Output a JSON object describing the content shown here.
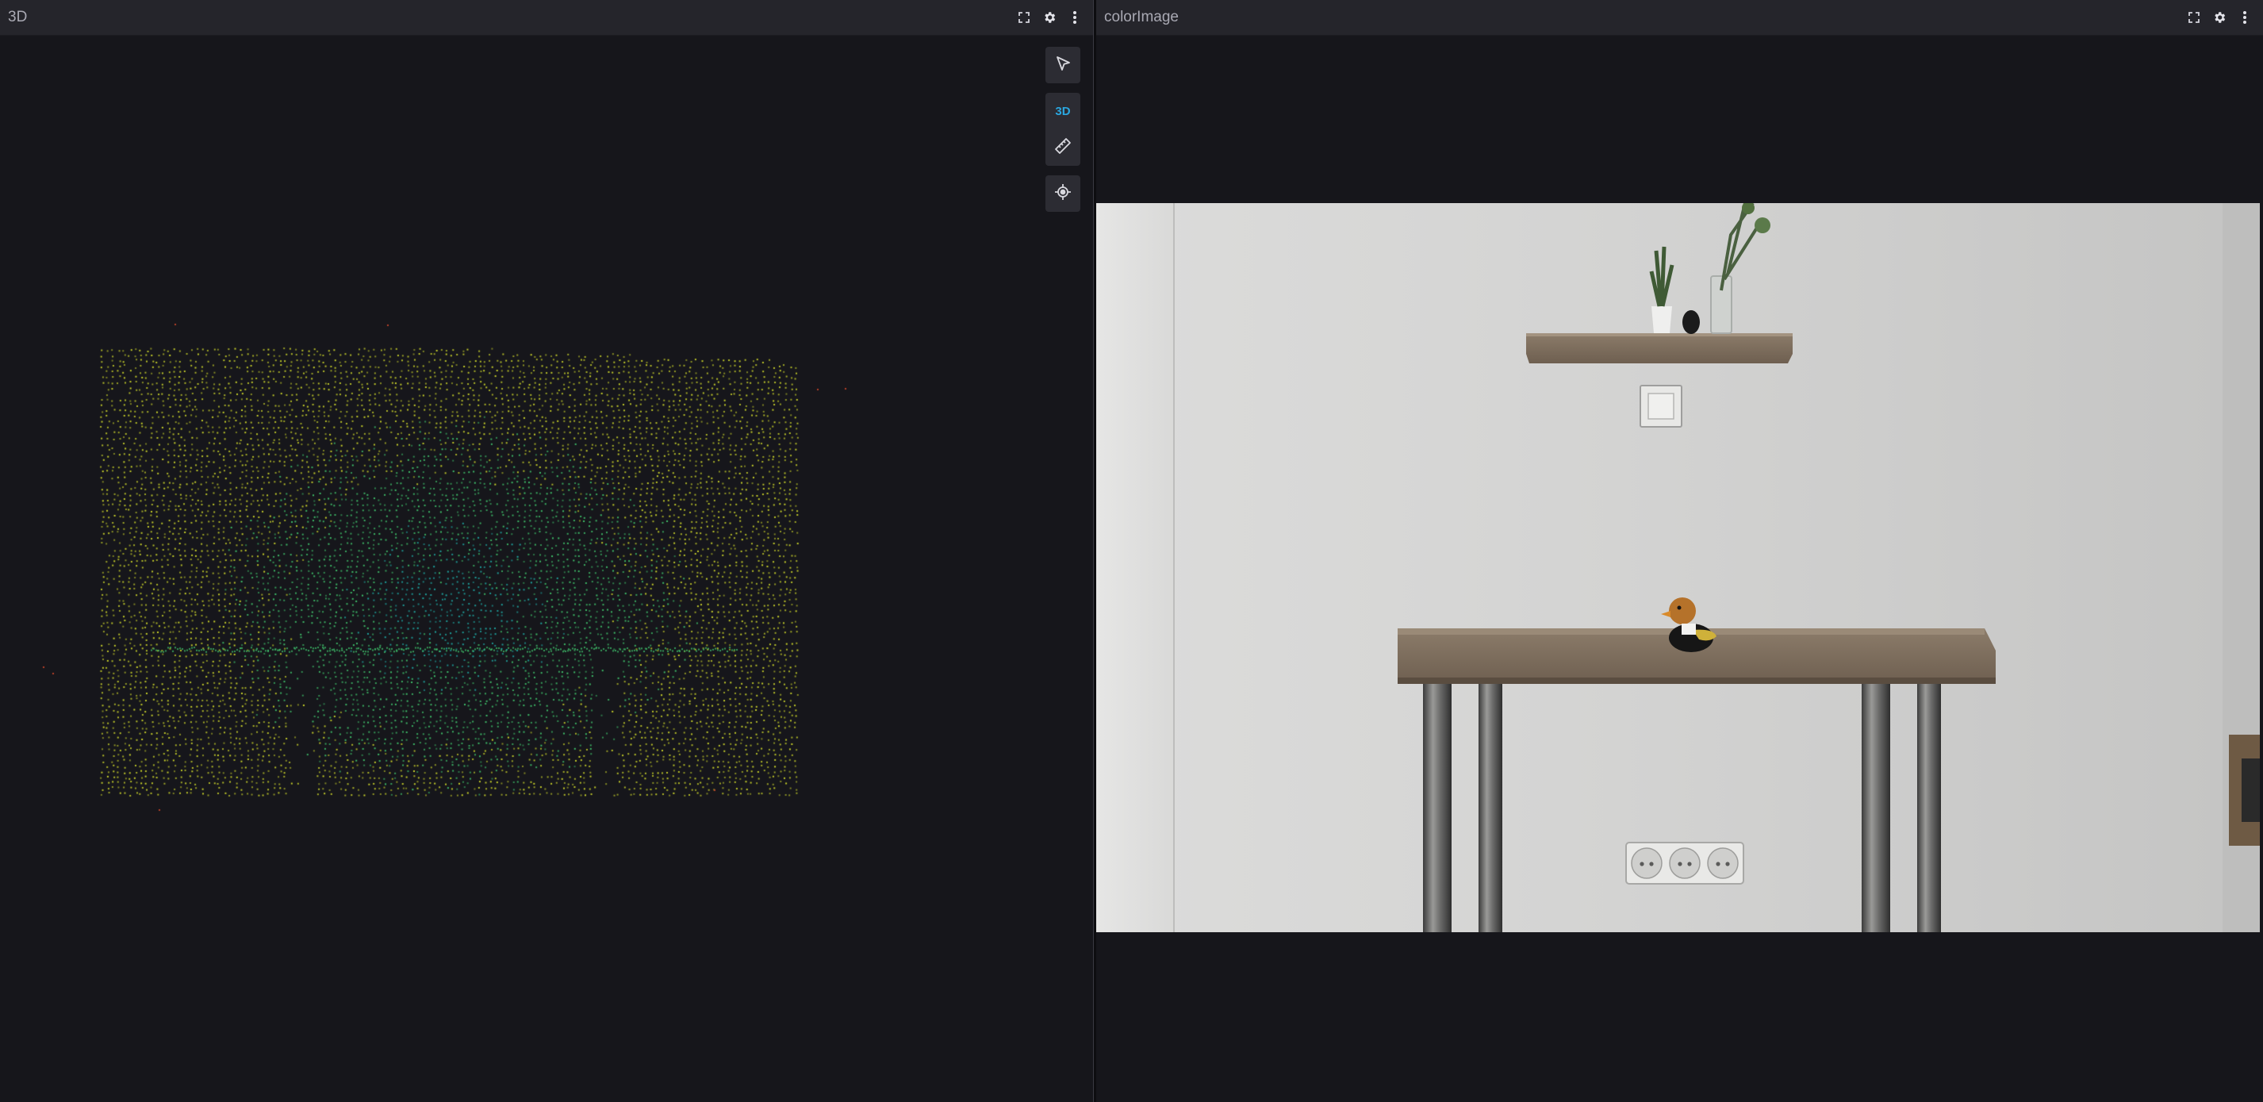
{
  "panels": {
    "left": {
      "title": "3D",
      "header_icons": [
        "fullscreen-icon",
        "gear-icon",
        "more-vertical-icon"
      ],
      "toolbar": {
        "select_icon": "cursor-arrow-icon",
        "mode_label": "3D",
        "measure_icon": "ruler-icon",
        "follow_icon": "target-icon"
      }
    },
    "right": {
      "title": "colorImage",
      "header_icons": [
        "fullscreen-icon",
        "gear-icon",
        "more-vertical-icon"
      ]
    }
  },
  "colors": {
    "background": "#16161b",
    "header": "#25252b",
    "accent": "#2aa7e0",
    "point_cloud_yellow": "#c8d12a",
    "point_cloud_green": "#3fbf6a",
    "point_cloud_teal": "#1fa5a0"
  }
}
